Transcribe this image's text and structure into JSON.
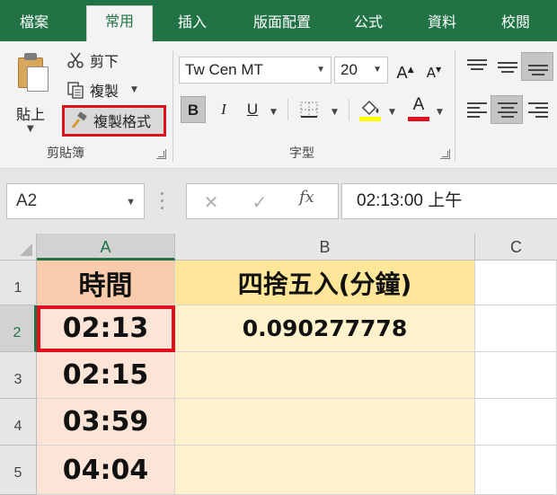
{
  "tabs": [
    {
      "label": "檔案",
      "active": false
    },
    {
      "label": "常用",
      "active": true
    },
    {
      "label": "插入",
      "active": false
    },
    {
      "label": "版面配置",
      "active": false
    },
    {
      "label": "公式",
      "active": false
    },
    {
      "label": "資料",
      "active": false
    },
    {
      "label": "校閱",
      "active": false
    }
  ],
  "ribbon": {
    "clipboard": {
      "paste_label": "貼上",
      "cut_label": "剪下",
      "copy_label": "複製",
      "format_painter_label": "複製格式",
      "group_label": "剪貼簿"
    },
    "font": {
      "font_name": "Tw Cen MT",
      "font_size": "20",
      "grow_label": "A",
      "shrink_label": "A",
      "bold_label": "B",
      "italic_label": "I",
      "underline_label": "U",
      "font_color_label": "A",
      "group_label": "字型"
    }
  },
  "formula_bar": {
    "name_box": "A2",
    "cancel_symbol": "✕",
    "enter_symbol": "✓",
    "fx_label": "fx",
    "formula_value": "02:13:00 上午"
  },
  "grid": {
    "column_headers": [
      "A",
      "B",
      "C"
    ],
    "row_headers": [
      "1",
      "2",
      "3",
      "4",
      "5"
    ],
    "cells": {
      "A1": "時間",
      "B1": "四捨五入(分鐘)",
      "A2": "02:13",
      "B2": "0.090277778",
      "A3": "02:15",
      "A4": "03:59",
      "A5": "04:04"
    },
    "active_cell": "A2"
  },
  "colors": {
    "excel_green": "#217346",
    "highlight_red": "#e0101c",
    "header_a_fill": "#f8cbad",
    "header_b_fill": "#ffe699",
    "col_a_fill": "#fce4d6",
    "col_b_fill": "#fff2cc"
  }
}
